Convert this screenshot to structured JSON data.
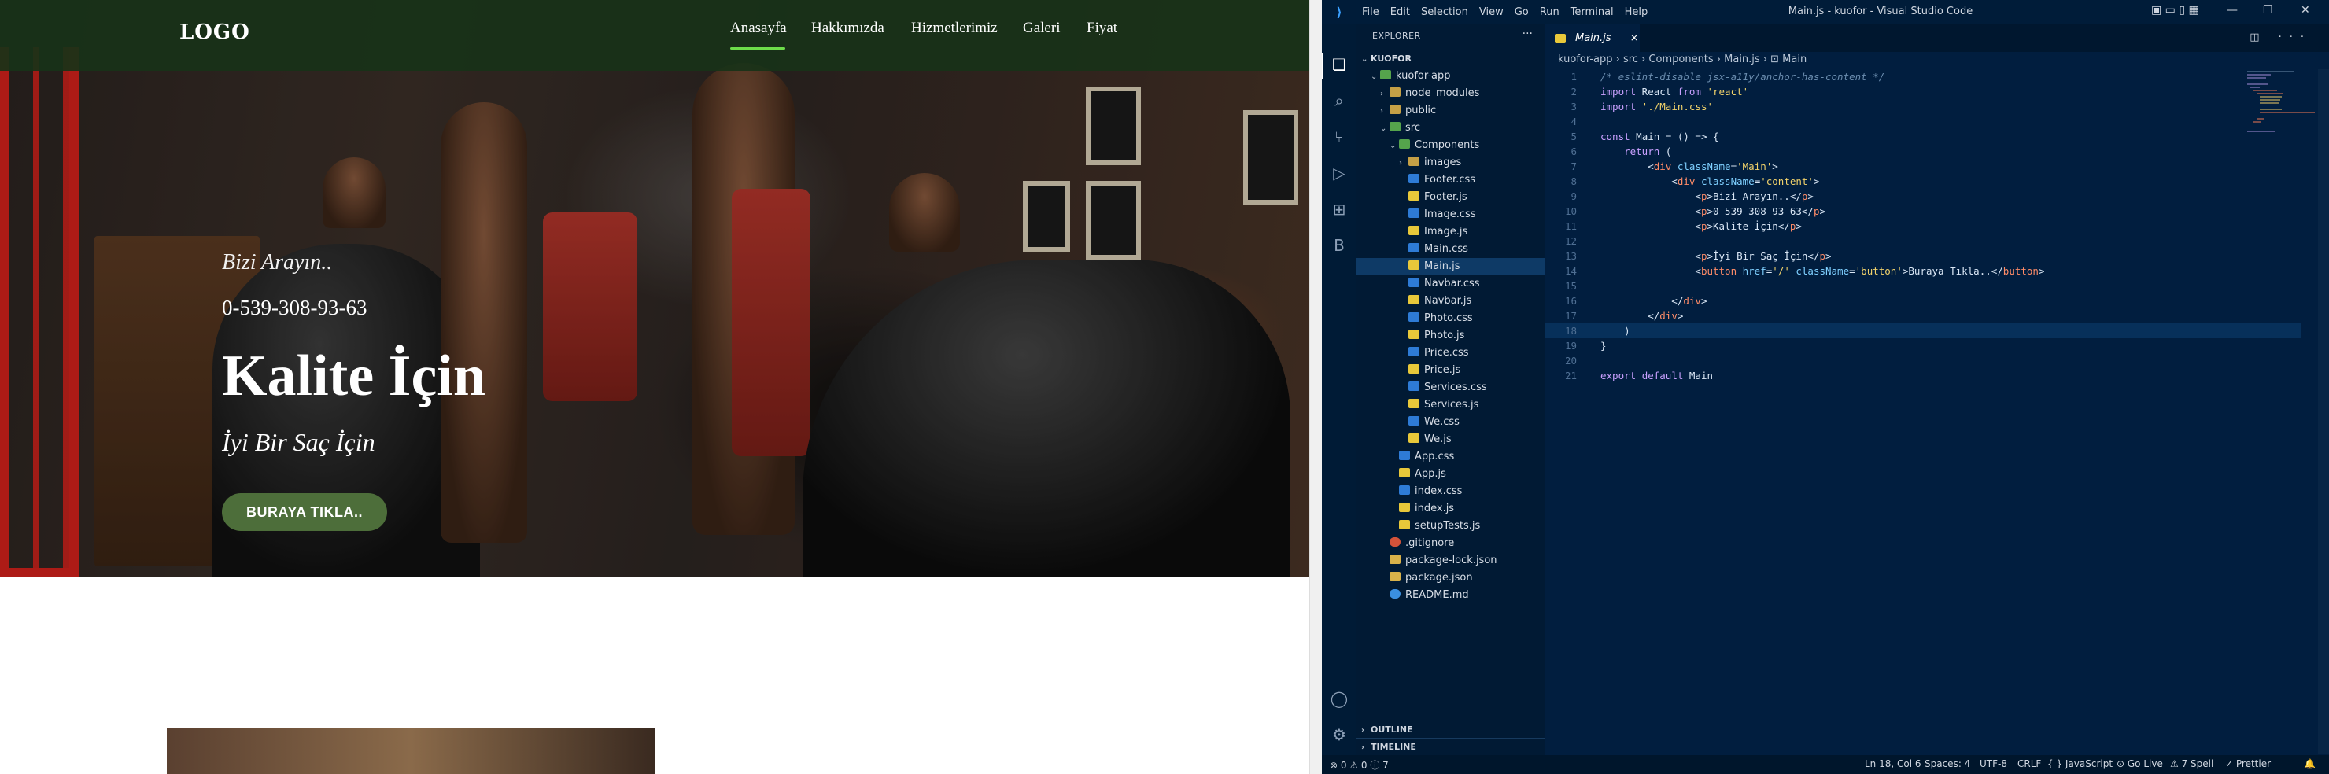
{
  "website": {
    "logo": "LOGO",
    "nav": [
      "Anasayfa",
      "Hakkımızda",
      "Hizmetlerimiz",
      "Galeri",
      "Fiyat"
    ],
    "hero": {
      "small": "Bizi Arayın..",
      "phone": "0-539-308-93-63",
      "title": "Kalite İçin",
      "subtitle": "İyi Bir Saç İçin",
      "cta": "BURAYA TIKLA.."
    }
  },
  "vscode": {
    "menu": [
      "File",
      "Edit",
      "Selection",
      "View",
      "Go",
      "Run",
      "Terminal",
      "Help"
    ],
    "window_title": "Main.js - kuofor - Visual Studio Code",
    "sidebar": {
      "title": "EXPLORER",
      "root": "KUOFOR",
      "tree": [
        {
          "label": "kuofor-app",
          "indent": 1,
          "kind": "folder-open"
        },
        {
          "label": "node_modules",
          "indent": 2,
          "kind": "folder"
        },
        {
          "label": "public",
          "indent": 2,
          "kind": "folder"
        },
        {
          "label": "src",
          "indent": 2,
          "kind": "folder-open"
        },
        {
          "label": "Components",
          "indent": 3,
          "kind": "folder-open"
        },
        {
          "label": "images",
          "indent": 4,
          "kind": "folder"
        },
        {
          "label": "Footer.css",
          "indent": 4,
          "kind": "css"
        },
        {
          "label": "Footer.js",
          "indent": 4,
          "kind": "js"
        },
        {
          "label": "Image.css",
          "indent": 4,
          "kind": "css"
        },
        {
          "label": "Image.js",
          "indent": 4,
          "kind": "js"
        },
        {
          "label": "Main.css",
          "indent": 4,
          "kind": "css"
        },
        {
          "label": "Main.js",
          "indent": 4,
          "kind": "js",
          "selected": true
        },
        {
          "label": "Navbar.css",
          "indent": 4,
          "kind": "css"
        },
        {
          "label": "Navbar.js",
          "indent": 4,
          "kind": "js"
        },
        {
          "label": "Photo.css",
          "indent": 4,
          "kind": "css"
        },
        {
          "label": "Photo.js",
          "indent": 4,
          "kind": "js"
        },
        {
          "label": "Price.css",
          "indent": 4,
          "kind": "css"
        },
        {
          "label": "Price.js",
          "indent": 4,
          "kind": "js"
        },
        {
          "label": "Services.css",
          "indent": 4,
          "kind": "css"
        },
        {
          "label": "Services.js",
          "indent": 4,
          "kind": "js"
        },
        {
          "label": "We.css",
          "indent": 4,
          "kind": "css"
        },
        {
          "label": "We.js",
          "indent": 4,
          "kind": "js"
        },
        {
          "label": "App.css",
          "indent": 3,
          "kind": "css"
        },
        {
          "label": "App.js",
          "indent": 3,
          "kind": "js"
        },
        {
          "label": "index.css",
          "indent": 3,
          "kind": "css"
        },
        {
          "label": "index.js",
          "indent": 3,
          "kind": "js"
        },
        {
          "label": "setupTests.js",
          "indent": 3,
          "kind": "js"
        },
        {
          "label": ".gitignore",
          "indent": 2,
          "kind": "git"
        },
        {
          "label": "package-lock.json",
          "indent": 2,
          "kind": "json"
        },
        {
          "label": "package.json",
          "indent": 2,
          "kind": "json"
        },
        {
          "label": "README.md",
          "indent": 2,
          "kind": "info"
        }
      ],
      "outline": "OUTLINE",
      "timeline": "TIMELINE"
    },
    "tab": {
      "label": "Main.js",
      "close": "×"
    },
    "breadcrumb": "kuofor-app  ›  src  ›  Components  ›  Main.js  ›  ⊡ Main",
    "code": [
      "/* eslint-disable jsx-a11y/anchor-has-content */",
      "import React from 'react'",
      "import './Main.css'",
      "",
      "const Main = () => {",
      "    return (",
      "        <div className='Main'>",
      "            <div className='content'>",
      "                <p>Bizi Arayın..</p>",
      "                <p>0-539-308-93-63</p>",
      "                <p>Kalite İçin</p>",
      "",
      "                <p>İyi Bir Saç İçin</p>",
      "                <button href='/' className='button'>Buraya Tıkla..</button>",
      "",
      "            </div>",
      "        </div>",
      "    )",
      "}",
      "",
      "export default Main"
    ],
    "active_line": 18,
    "status": {
      "problems": "⊗ 0 ⚠ 0 ⓘ 7",
      "position": "Ln 18, Col 6",
      "spaces": "Spaces: 4",
      "encoding": "UTF-8",
      "eol": "CRLF",
      "language": "{ } JavaScript",
      "golive": "⊙ Go Live",
      "spell": "⚠ 7 Spell",
      "prettier": "✓ Prettier",
      "bell": "🔔"
    }
  },
  "colors": {
    "navbar": "#183218",
    "cta": "#4d6e3a",
    "vscode_bg": "#011e3f",
    "active_nav_underline": "#6ddc4a"
  }
}
